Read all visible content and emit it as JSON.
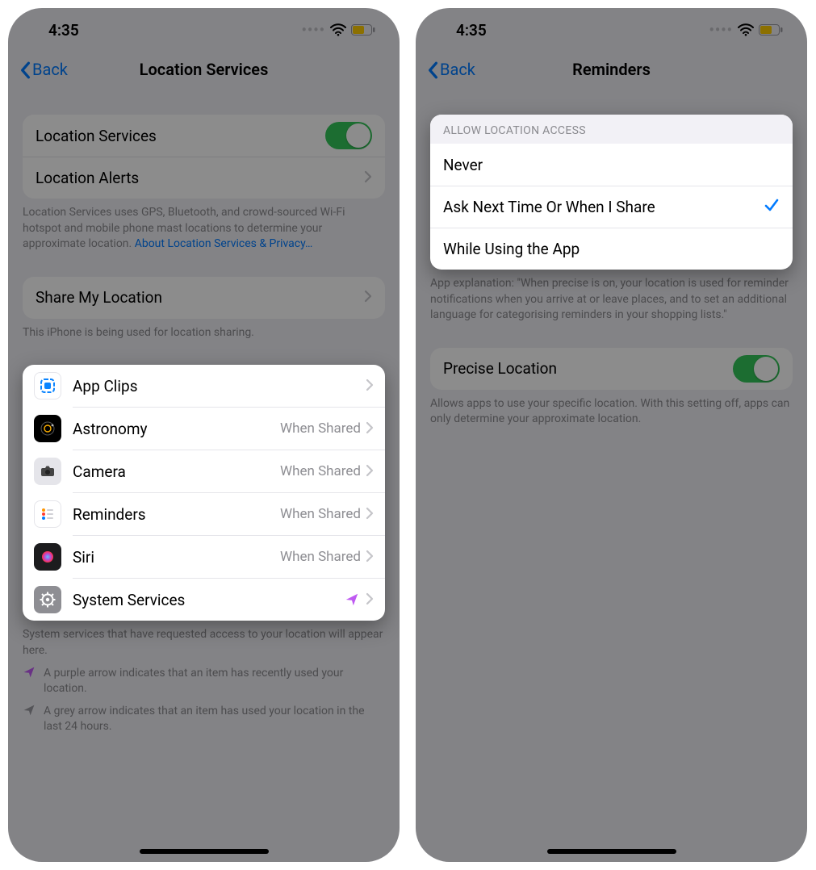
{
  "status": {
    "time": "4:35"
  },
  "left": {
    "back": "Back",
    "title": "Location Services",
    "row_location_services": "Location Services",
    "row_location_alerts": "Location Alerts",
    "footnote_services": "Location Services uses GPS, Bluetooth, and crowd-sourced Wi-Fi hotspot and mobile phone mast locations to determine your approximate location. ",
    "footnote_services_link": "About Location Services & Privacy…",
    "row_share": "Share My Location",
    "footnote_share": "This iPhone is being used for location sharing.",
    "apps": [
      {
        "name": "App Clips",
        "status": ""
      },
      {
        "name": "Astronomy",
        "status": "When Shared"
      },
      {
        "name": "Camera",
        "status": "When Shared"
      },
      {
        "name": "Reminders",
        "status": "When Shared"
      },
      {
        "name": "Siri",
        "status": "When Shared"
      },
      {
        "name": "System Services",
        "status": ""
      }
    ],
    "footnote_system": "System services that have requested access to your location will appear here.",
    "footnote_purple": "A purple arrow indicates that an item has recently used your location.",
    "footnote_grey": "A grey arrow indicates that an item has used your location in the last 24 hours."
  },
  "right": {
    "back": "Back",
    "title": "Reminders",
    "section_header": "ALLOW LOCATION ACCESS",
    "options": [
      {
        "label": "Never",
        "selected": false
      },
      {
        "label": "Ask Next Time Or When I Share",
        "selected": true
      },
      {
        "label": "While Using the App",
        "selected": false
      }
    ],
    "footnote_explain": "App explanation: \"When precise is on, your location is used for reminder notifications when you arrive at or leave places, and to set an additional language for categorising reminders in your shopping lists.\"",
    "row_precise": "Precise Location",
    "footnote_precise": "Allows apps to use your specific location. With this setting off, apps can only determine your approximate location."
  }
}
